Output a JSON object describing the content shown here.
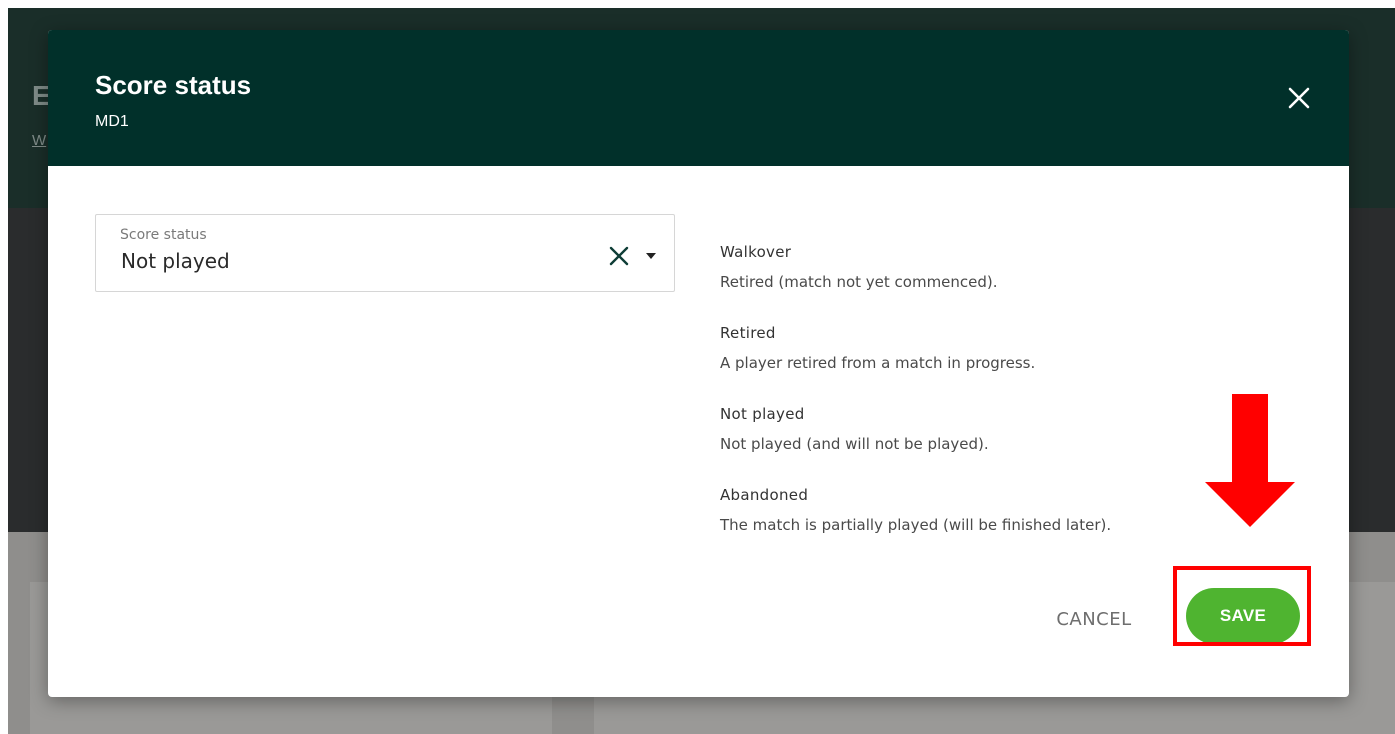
{
  "background": {
    "title_fragment": "E",
    "link_fragment": "W"
  },
  "modal": {
    "title": "Score status",
    "subtitle": "MD1",
    "close_icon": "close-icon"
  },
  "score_status_field": {
    "label": "Score status",
    "value": "Not played",
    "clear_icon": "clear-icon",
    "dropdown_icon": "caret-down-icon"
  },
  "descriptions": [
    {
      "title": "Walkover",
      "text": "Retired (match not yet commenced)."
    },
    {
      "title": "Retired",
      "text": "A player retired from a match in progress."
    },
    {
      "title": "Not played",
      "text": "Not played (and will not be played)."
    },
    {
      "title": "Abandoned",
      "text": "The match is partially played (will be finished later)."
    }
  ],
  "footer": {
    "cancel_label": "CANCEL",
    "save_label": "SAVE"
  },
  "colors": {
    "header": "#01302a",
    "save": "#4fb430",
    "annotation": "#ff0000"
  },
  "annotations": {
    "arrow_icon": "arrow-down-icon",
    "highlight": "save-highlight-box"
  }
}
